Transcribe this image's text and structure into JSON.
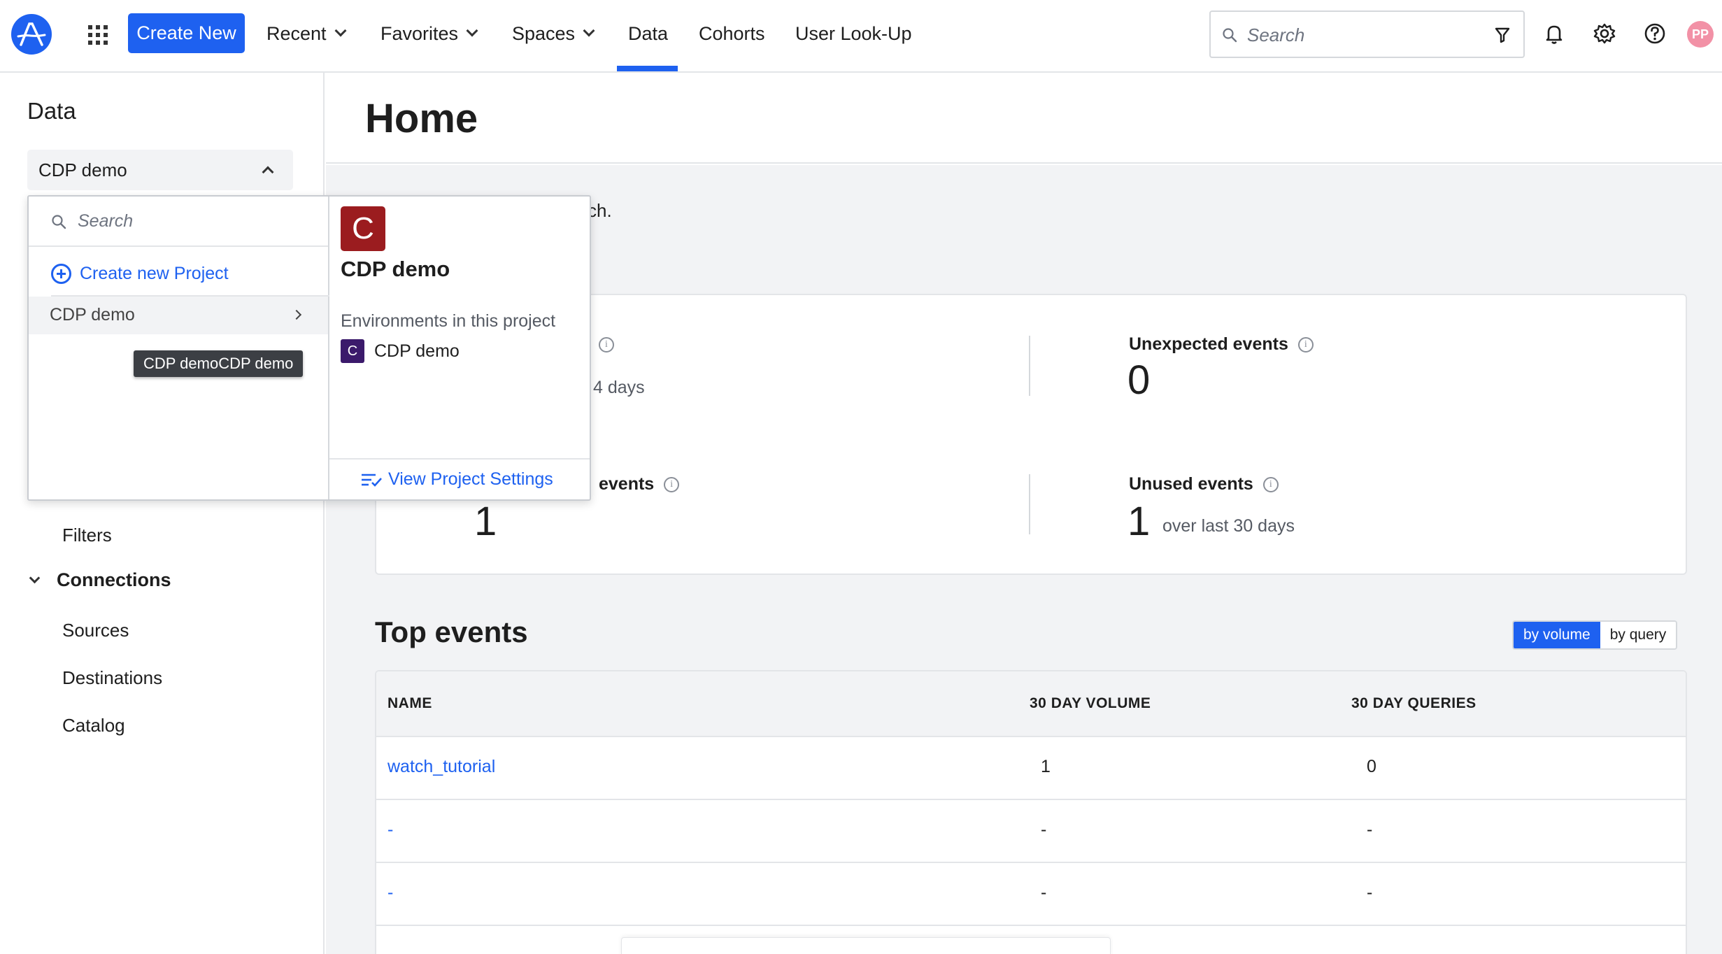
{
  "nav": {
    "create_new": "Create New",
    "recent": "Recent",
    "favorites": "Favorites",
    "spaces": "Spaces",
    "data": "Data",
    "cohorts": "Cohorts",
    "user_lookup": "User Look-Up",
    "search_placeholder": "Search",
    "avatar_initials": "PP",
    "active_tab": "Data",
    "accent_color": "#1e61f0"
  },
  "sidebar": {
    "title": "Data",
    "project_selected": "CDP demo",
    "links": {
      "filters": "Filters",
      "sources": "Sources",
      "destinations": "Destinations",
      "catalog": "Catalog"
    },
    "connections_label": "Connections"
  },
  "dropdown": {
    "search_placeholder": "Search",
    "create_project": "Create new Project",
    "project_item": "CDP demo",
    "tooltip": "CDP demoCDP demo",
    "detail": {
      "badge_letter": "C",
      "project_name": "CDP demo",
      "env_label": "Environments in this project",
      "env_badge": "C",
      "env_name": "CDP demo",
      "view_settings": "View Project Settings"
    }
  },
  "main": {
    "title": "Home",
    "intro_fragment": "ch.",
    "stats": {
      "s1_fragment": "4 days",
      "s2_label_fragment": "events",
      "s2_value": "1",
      "unexpected_label": "Unexpected events",
      "unexpected_value": "0",
      "unused_label": "Unused events",
      "unused_value": "1",
      "unused_sub": "over last 30 days"
    },
    "top_events": {
      "title": "Top events",
      "toggle": [
        "by volume",
        "by query"
      ],
      "toggle_active": "by volume",
      "columns": [
        "NAME",
        "30 DAY VOLUME",
        "30 DAY QUERIES"
      ],
      "rows": [
        {
          "name": "watch_tutorial",
          "volume": "1",
          "queries": "0"
        },
        {
          "name": "-",
          "volume": "-",
          "queries": "-"
        },
        {
          "name": "-",
          "volume": "-",
          "queries": "-"
        }
      ]
    }
  },
  "icons": [
    "amplitude-logo-icon",
    "apps-grid-icon",
    "search-icon",
    "filter-icon",
    "bell-icon",
    "gear-icon",
    "help-icon",
    "plus-circle-icon",
    "chevron-right-icon",
    "info-icon",
    "list-check-icon"
  ]
}
